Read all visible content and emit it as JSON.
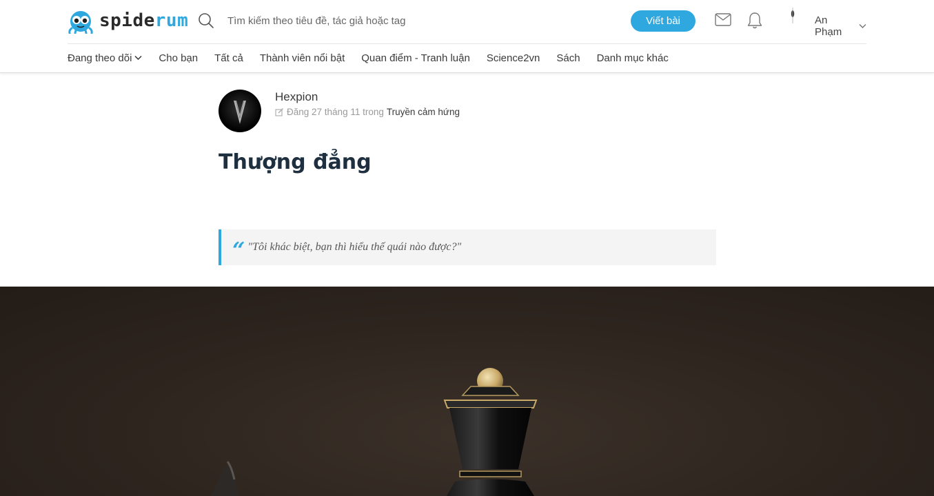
{
  "header": {
    "logo": {
      "part1": "spide",
      "part2": "rum"
    },
    "search": {
      "placeholder": "Tìm kiếm theo tiêu đề, tác giả hoặc tag"
    },
    "write_button": "Viết bài",
    "user": {
      "name": "An Phạm"
    }
  },
  "nav": {
    "items": [
      {
        "label": "Đang theo dõi",
        "has_dropdown": true
      },
      {
        "label": "Cho bạn"
      },
      {
        "label": "Tất cả"
      },
      {
        "label": "Thành viên nổi bật"
      },
      {
        "label": "Quan điểm - Tranh luận"
      },
      {
        "label": "Science2vn"
      },
      {
        "label": "Sách"
      },
      {
        "label": "Danh mục khác"
      }
    ]
  },
  "article": {
    "author": "Hexpion",
    "meta_prefix": "Đăng 27 tháng 11 trong",
    "category": "Truyền cảm hứng",
    "title": "Thượng đẳng",
    "quote": "\"Tôi khác biệt, bạn thì hiểu thế quái nào được?\""
  },
  "colors": {
    "accent": "#2fa8e0",
    "title": "#1e3040",
    "hero_bg": "#2d241e"
  }
}
